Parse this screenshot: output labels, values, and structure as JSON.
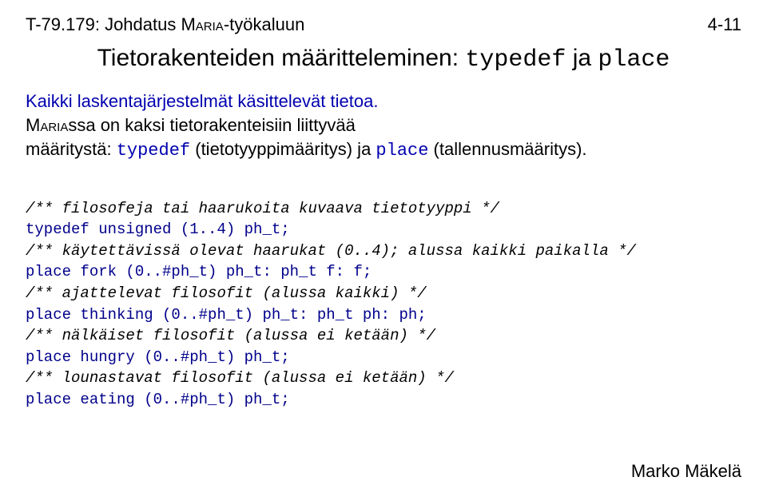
{
  "header": {
    "left_prefix": "T-79.179: Johdatus ",
    "left_tool": "Maria",
    "left_suffix": "-työkaluun",
    "right": "4-11"
  },
  "title": {
    "text": "Tietorakenteiden määritteleminen: ",
    "kw1": "typedef",
    "mid": " ja ",
    "kw2": "place"
  },
  "intro": {
    "line1": "Kaikki laskentajärjestelmät käsittelevät tietoa.",
    "line2a": "Maria",
    "line2b": "ssa on kaksi tietorakenteisiin liittyvää",
    "line3a": "määritystä: ",
    "line3_kw1": "typedef",
    "line3b": " (tietotyyppimääritys) ja ",
    "line3_kw2": "place",
    "line3c": " (tallennusmääritys)."
  },
  "code": {
    "c1": "/** filosofeja tai haarukoita kuvaava tietotyyppi */",
    "l1": "typedef unsigned (1..4) ph_t;",
    "c2": "/** käytettävissä olevat haarukat (0..4); alussa kaikki paikalla */",
    "l2": "place fork (0..#ph_t) ph_t: ph_t f: f;",
    "c3": "/** ajattelevat filosofit (alussa kaikki) */",
    "l3": "place thinking (0..#ph_t) ph_t: ph_t ph: ph;",
    "c4": "/** nälkäiset filosofit (alussa ei ketään) */",
    "l4": "place hungry (0..#ph_t) ph_t;",
    "c5": "/** lounastavat filosofit (alussa ei ketään) */",
    "l5": "place eating (0..#ph_t) ph_t;"
  },
  "footer": "Marko Mäkelä"
}
